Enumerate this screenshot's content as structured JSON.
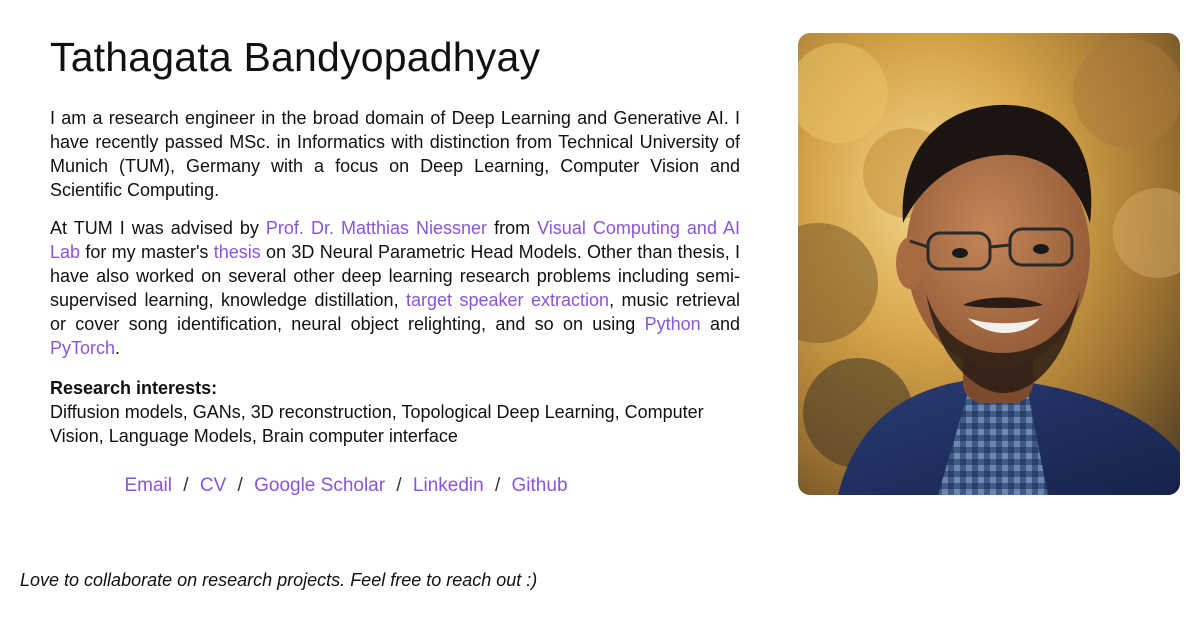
{
  "profile": {
    "name": "Tathagata Bandyopadhyay",
    "bio1": "I am a research engineer in the broad domain of Deep Learning and Generative AI. I have recently passed MSc. in Informatics with distinction from Technical University of Munich (TUM), Germany with a focus on Deep Learning, Computer Vision and Scientific Computing.",
    "bio2": {
      "t1": "At TUM I was advised by ",
      "advisor_link": "Prof. Dr. Matthias Niessner",
      "t2": " from ",
      "lab_link": "Visual Computing and AI Lab",
      "t3": " for my master's ",
      "thesis_link": "thesis",
      "t4": " on 3D Neural Parametric Head Models. Other than thesis, I have also worked on several other deep learning research problems including semi-supervised learning, knowledge distillation, ",
      "tse_link": "target speaker extraction",
      "t5": ", music retrieval or cover song identification, neural object relighting, and so on using ",
      "python_link": "Python",
      "t6": " and ",
      "pytorch_link": "PyTorch",
      "t7": "."
    },
    "interests_label": "Research interests:",
    "interests_text": "Diffusion models, GANs, 3D reconstruction, Topological Deep Learning, Computer Vision, Language Models, Brain computer interface",
    "links": {
      "email": "Email",
      "cv": "CV",
      "scholar": "Google Scholar",
      "linkedin": "Linkedin",
      "github": "Github",
      "separator": "/"
    },
    "closing": "Love to collaborate on research projects. Feel free to reach out :)"
  },
  "colors": {
    "link": "#8a55d8",
    "text": "#111111",
    "background": "#ffffff"
  },
  "photo": {
    "icon": "portrait-photo"
  }
}
